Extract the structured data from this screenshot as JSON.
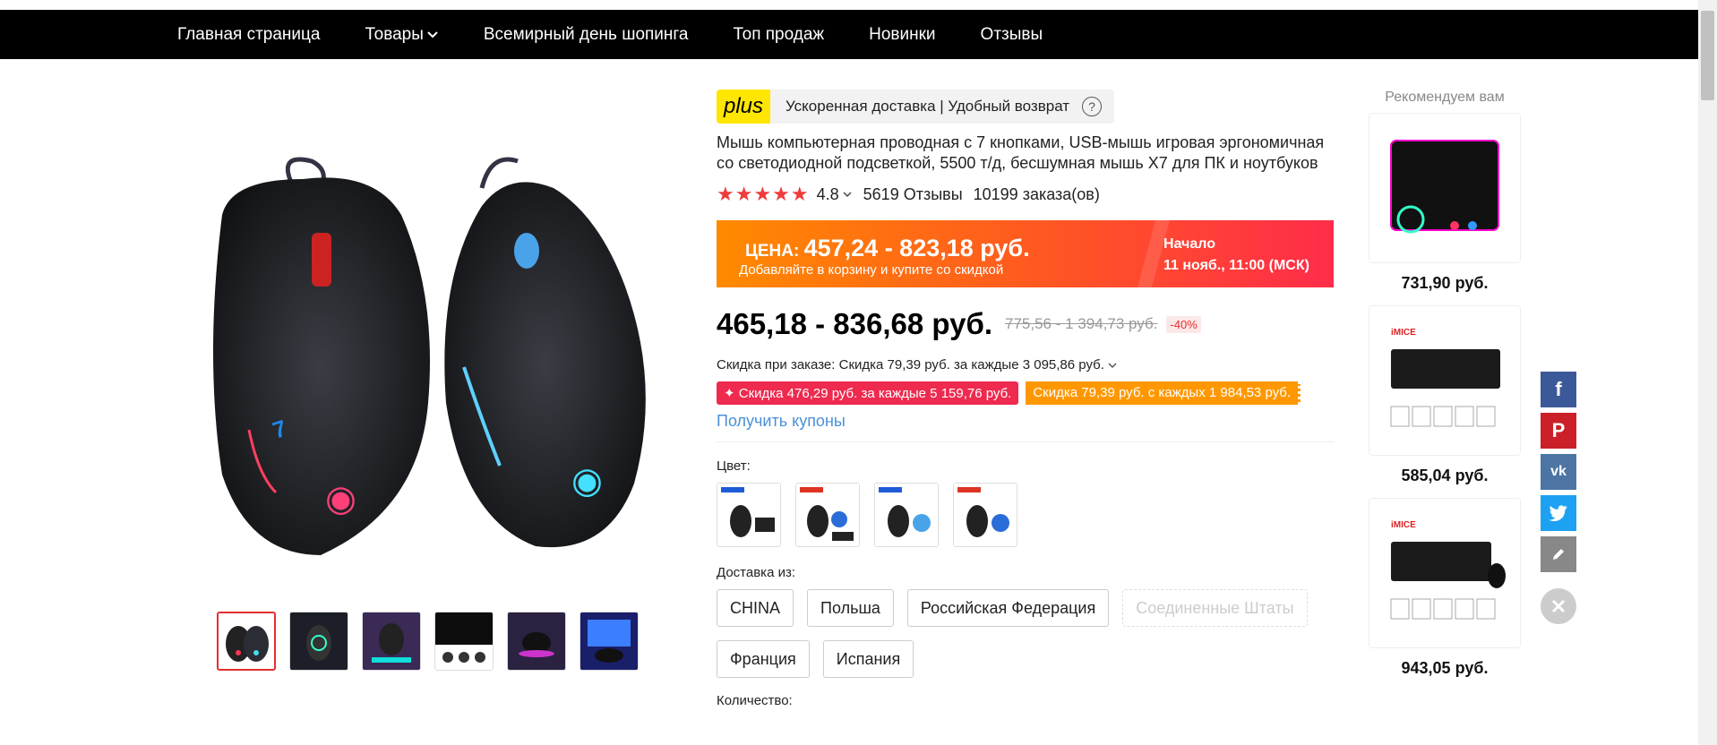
{
  "nav": {
    "items": [
      {
        "label": "Главная страница"
      },
      {
        "label": "Товары"
      },
      {
        "label": "Всемирный день шопинга"
      },
      {
        "label": "Топ продаж"
      },
      {
        "label": "Новинки"
      },
      {
        "label": "Отзывы"
      }
    ]
  },
  "plus": {
    "logo": "plus",
    "text": "Ускоренная доставка | Удобный возврат",
    "help_icon": "question-circle-icon"
  },
  "product": {
    "title": "Мышь компьютерная проводная с 7 кнопками, USB-мышь игровая эргономичная со светодиодной подсветкой, 5500 т/д, бесшумная мышь X7 для ПК и ноутбуков",
    "stars": "★★★★★",
    "rating": "4.8",
    "reviews": "5619 Отзывы",
    "orders": "10199 заказа(ов)",
    "price": "465,18 - 836,68 руб.",
    "old_price": "775,56 - 1 394,73 руб.",
    "discount": "-40%"
  },
  "promo": {
    "price_label": "ЦЕНА:",
    "price_value": "457,24 - 823,18 руб.",
    "sub": "Добавляйте в корзину и купите со скидкой",
    "start_label": "Начало",
    "start_date": "11 нояб., 11:00 (МСК)"
  },
  "discounts": {
    "line": "Скидка при заказе: Скидка 79,39 руб. за каждые 3 095,86 руб.",
    "coupon_red": "✦ Скидка 476,29 руб. за каждые 5 159,76 руб.",
    "coupon_orange": "Скидка 79,39 руб. с каждых 1 984,53 руб.",
    "get_coupons": "Получить купоны"
  },
  "options": {
    "color_label": "Цвет:",
    "ship_label": "Доставка из:",
    "ship_from": [
      "CHINA",
      "Польша",
      "Российская Федерация",
      "Соединенные Штаты",
      "Франция",
      "Испания"
    ],
    "qty_label": "Количество:"
  },
  "recommend": {
    "title": "Рекомендуем вам",
    "prices": [
      "731,90 руб.",
      "585,04 руб.",
      "943,05 руб."
    ]
  },
  "colors": {
    "nav_bg": "#000000",
    "accent_red": "#e62e2e",
    "link_blue": "#4a90d9",
    "plus_yellow": "#ffe600",
    "facebook": "#3b5998",
    "pinterest": "#cb2027",
    "vk": "#4c75a3",
    "twitter": "#1da1f2"
  }
}
